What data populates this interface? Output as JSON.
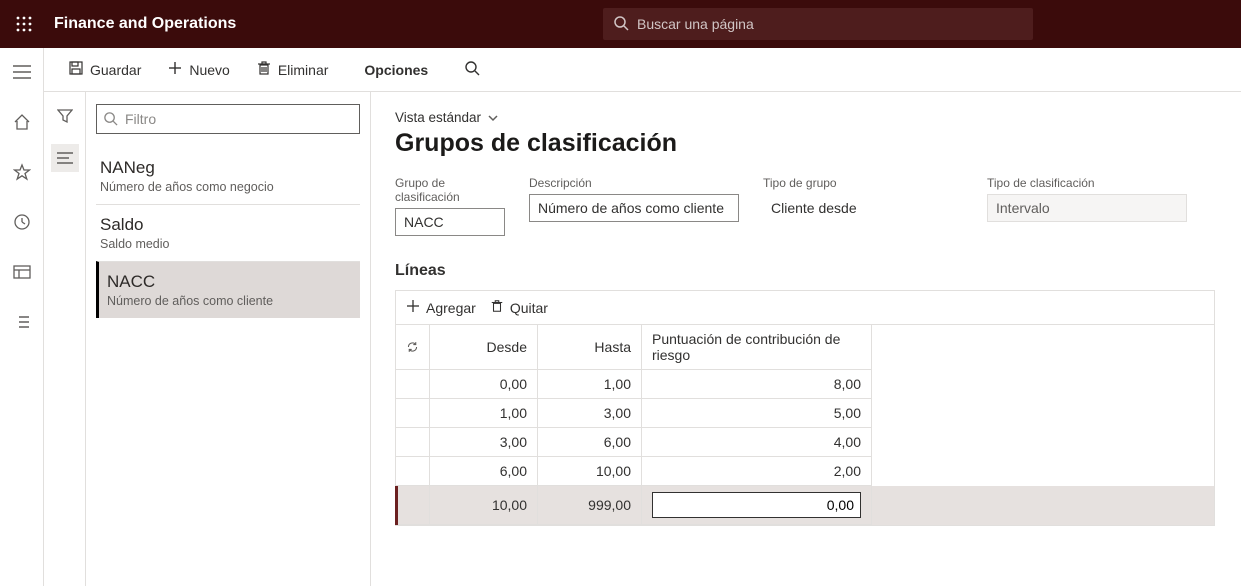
{
  "colors": {
    "brand": "#3b0b0b",
    "accent": "#6b2020"
  },
  "topbar": {
    "app_title": "Finance and Operations",
    "search_placeholder": "Buscar una página"
  },
  "actionbar": {
    "save": "Guardar",
    "new": "Nuevo",
    "delete": "Eliminar",
    "options": "Opciones"
  },
  "listpane": {
    "filter_placeholder": "Filtro",
    "items": [
      {
        "code": "NANeg",
        "desc": "Número de años como negocio",
        "selected": false
      },
      {
        "code": "Saldo",
        "desc": "Saldo medio",
        "selected": false
      },
      {
        "code": "NACC",
        "desc": "Número de años como cliente",
        "selected": true
      }
    ]
  },
  "detail": {
    "view_label": "Vista estándar",
    "page_title": "Grupos de clasificación",
    "fields": {
      "group_label": "Grupo de clasificación",
      "group_value": "NACC",
      "desc_label": "Descripción",
      "desc_value": "Número de años como cliente",
      "type_label": "Tipo de grupo",
      "type_value": "Cliente desde",
      "classtype_label": "Tipo de clasificación",
      "classtype_value": "Intervalo"
    },
    "lines": {
      "heading": "Líneas",
      "add_label": "Agregar",
      "remove_label": "Quitar",
      "columns": {
        "from": "Desde",
        "to": "Hasta",
        "score": "Puntuación de contribución de riesgo"
      },
      "rows": [
        {
          "from": "0,00",
          "to": "1,00",
          "score": "8,00",
          "selected": false
        },
        {
          "from": "1,00",
          "to": "3,00",
          "score": "5,00",
          "selected": false
        },
        {
          "from": "3,00",
          "to": "6,00",
          "score": "4,00",
          "selected": false
        },
        {
          "from": "6,00",
          "to": "10,00",
          "score": "2,00",
          "selected": false
        },
        {
          "from": "10,00",
          "to": "999,00",
          "score": "0,00",
          "selected": true
        }
      ]
    }
  }
}
